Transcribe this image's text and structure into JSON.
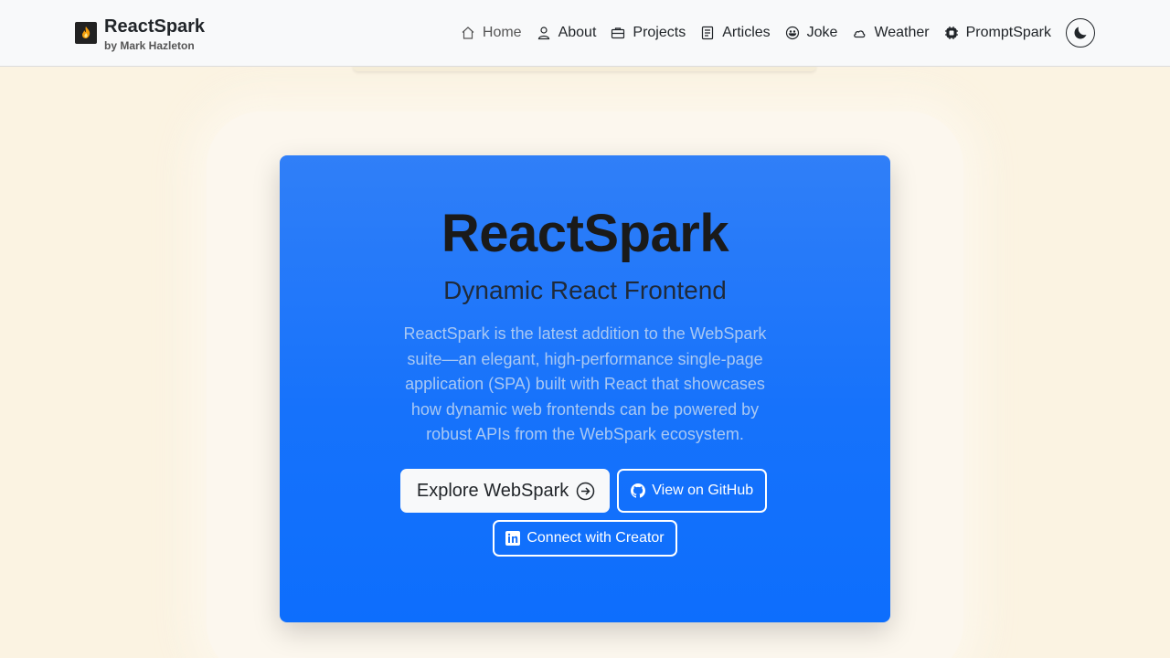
{
  "brand": {
    "title": "ReactSpark",
    "subtitle": "by Mark Hazleton"
  },
  "nav": {
    "items": [
      {
        "label": "Home",
        "icon": "home-icon",
        "active": true
      },
      {
        "label": "About",
        "icon": "person-icon"
      },
      {
        "label": "Projects",
        "icon": "briefcase-icon"
      },
      {
        "label": "Articles",
        "icon": "document-icon"
      },
      {
        "label": "Joke",
        "icon": "smile-icon"
      },
      {
        "label": "Weather",
        "icon": "cloud-icon"
      },
      {
        "label": "PromptSpark",
        "icon": "cpu-icon"
      }
    ],
    "theme_toggle_icon": "moon-icon"
  },
  "hero": {
    "title": "ReactSpark",
    "subtitle": "Dynamic React Frontend",
    "description": "ReactSpark is the latest addition to the WebSpark suite—an elegant, high-performance single-page application (SPA) built with React that showcases how dynamic web frontends can be powered by robust APIs from the WebSpark ecosystem.",
    "primary_button": "Explore WebSpark",
    "github_button": "View on GitHub",
    "linkedin_button": "Connect with Creator"
  },
  "colors": {
    "page_bg": "#fbf3e2",
    "navbar_bg": "#f8f9fa",
    "hero_gradient_top": "#307ff8",
    "hero_gradient_bottom": "#0d6efd"
  }
}
